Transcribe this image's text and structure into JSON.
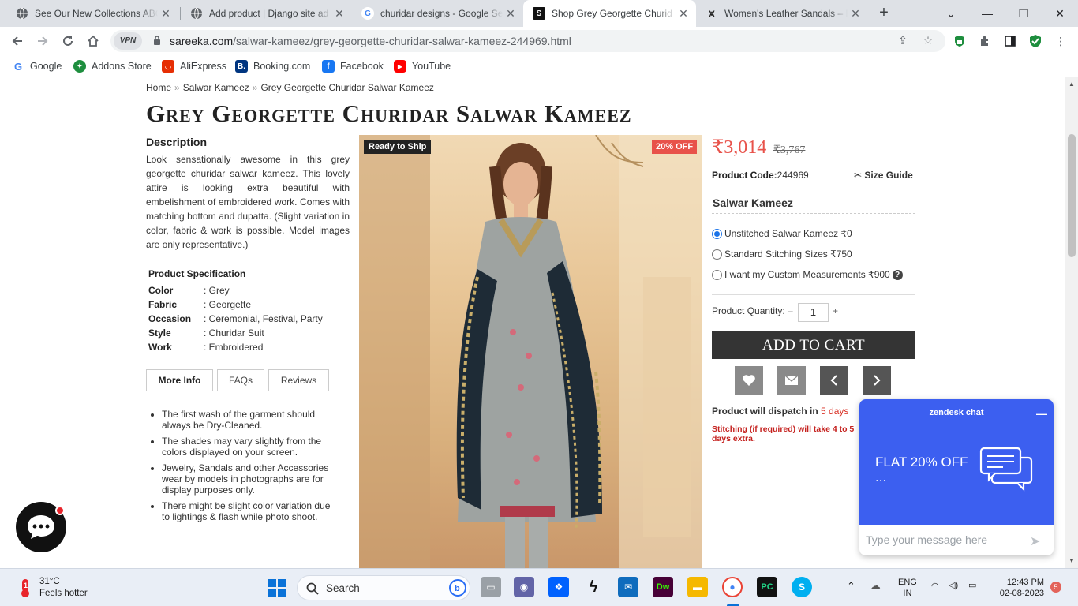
{
  "browser": {
    "tabs": [
      {
        "title": "See Our New Collections ABC",
        "favicon": "globe-icon"
      },
      {
        "title": "Add product | Django site ad",
        "favicon": "globe-icon"
      },
      {
        "title": "churidar designs - Google Se",
        "favicon": "google-icon"
      },
      {
        "title": "Shop Grey Georgette Churid",
        "favicon": "sareeka-icon",
        "active": true
      },
      {
        "title": "Women's Leather Sandals – F",
        "favicon": "sandals-icon"
      }
    ],
    "new_tab_label": "+",
    "url_domain": "sareeka.com",
    "url_path": "/salwar-kameez/grey-georgette-churidar-salwar-kameez-244969.html",
    "vpn_label": "VPN",
    "bookmarks": [
      {
        "label": "Google",
        "color": "#4285f4"
      },
      {
        "label": "Addons Store",
        "color": "#1e8e3e"
      },
      {
        "label": "AliExpress",
        "color": "#e62e04"
      },
      {
        "label": "Booking.com",
        "color": "#003580"
      },
      {
        "label": "Facebook",
        "color": "#1877f2"
      },
      {
        "label": "YouTube",
        "color": "#ff0000"
      }
    ]
  },
  "product": {
    "breadcrumb": [
      "Home",
      "Salwar Kameez",
      "Grey Georgette Churidar Salwar Kameez"
    ],
    "breadcrumb_sep": "»",
    "title": "Grey Georgette Churidar Salwar Kameez",
    "description_heading": "Description",
    "description": "Look sensationally awesome in this grey georgette churidar salwar kameez. This lovely attire is looking extra beautiful with embelishment of embroidered work. Comes with matching bottom and dupatta. (Slight variation in color, fabric & work is possible. Model images are only representative.)",
    "spec_heading": "Product Specification",
    "specs": [
      {
        "key": "Color",
        "value": ": Grey"
      },
      {
        "key": "Fabric",
        "value": ": Georgette"
      },
      {
        "key": "Occasion",
        "value": ": Ceremonial, Festival, Party"
      },
      {
        "key": "Style",
        "value": ": Churidar Suit"
      },
      {
        "key": "Work",
        "value": ": Embroidered"
      }
    ],
    "info_tabs": [
      "More Info",
      "FAQs",
      "Reviews"
    ],
    "info_points": [
      "The first wash of the garment should always be Dry-Cleaned.",
      "The shades may vary slightly from the colors displayed on your screen.",
      "Jewelry, Sandals and other Accessories wear by models in photographs are for display purposes only.",
      "There might be slight color variation due to lightings & flash while photo shoot."
    ],
    "badge_ship": "Ready to Ship",
    "badge_off": "20% OFF",
    "price": "₹3,014",
    "mrp": "₹3,767",
    "code_label": "Product Code:",
    "code": "244969",
    "size_guide": "Size Guide",
    "option_heading": "Salwar Kameez",
    "options": [
      {
        "label": "Unstitched Salwar Kameez ₹0",
        "selected": true
      },
      {
        "label": "Standard Stitching Sizes ₹750",
        "selected": false
      },
      {
        "label": "I want my Custom Measurements ₹900",
        "selected": false
      }
    ],
    "help_glyph": "?",
    "qty_label": "Product Quantity:",
    "qty_minus": "–",
    "qty": "1",
    "qty_plus": "+",
    "cart_label": "ADD TO CART",
    "dispatch_label": "Product will dispatch in",
    "dispatch_days": "5 days",
    "stitch_note": "Stitching (if required) will take 4 to 5 days extra."
  },
  "chat": {
    "widget_title": "zendesk chat",
    "promo": "FLAT 20% OFF ...",
    "placeholder": "Type your message here"
  },
  "taskbar": {
    "temp": "31°C",
    "weather": "Feels hotter",
    "weather_badge": "1",
    "search_label": "Search",
    "lang1": "ENG",
    "lang2": "IN",
    "time": "12:43 PM",
    "date": "02-08-2023",
    "notif_count": "5"
  },
  "colors": {
    "accent_price": "#e8524a",
    "cart_bg": "#343434",
    "zendesk": "#3c5ff0"
  }
}
